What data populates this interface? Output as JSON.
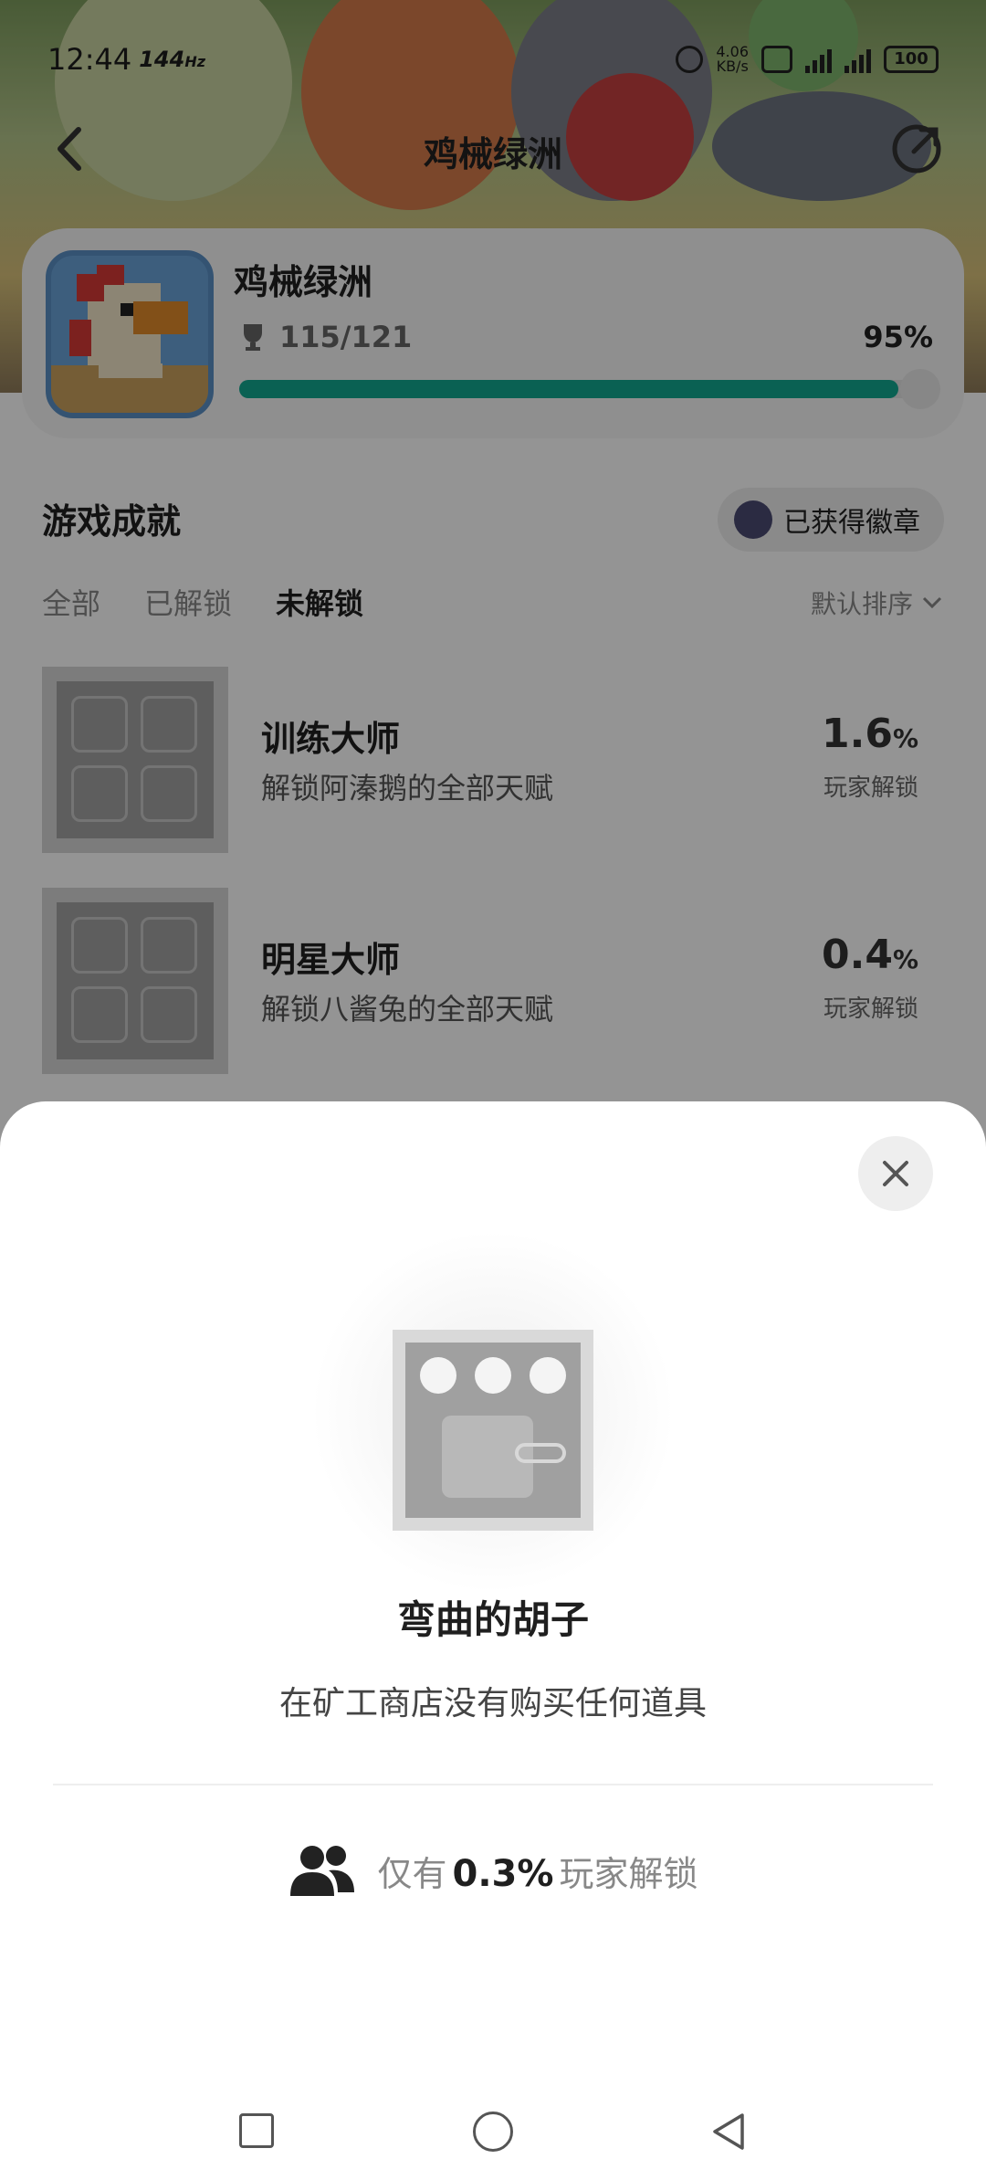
{
  "status_bar": {
    "time": "12:44",
    "refresh_rate": "144",
    "refresh_unit": "Hz",
    "net_speed": "4.06",
    "net_unit": "KB/s",
    "battery": "100"
  },
  "header": {
    "title": "鸡械绿洲"
  },
  "game_card": {
    "name": "鸡械绿洲",
    "trophy_count": "115/121",
    "percent_text": "95%",
    "progress": 0.95,
    "accent_color": "#12a78f"
  },
  "achievements_section": {
    "title": "游戏成就",
    "badges_button": "已获得徽章",
    "filters": [
      "全部",
      "已解锁",
      "未解锁"
    ],
    "active_filter": "未解锁",
    "sort_label": "默认排序",
    "items": [
      {
        "title": "训练大师",
        "desc": "解锁阿溱鹅的全部天赋",
        "value": "1.6",
        "unit": "%",
        "unlock_label": "玩家解锁"
      },
      {
        "title": "明星大师",
        "desc": "解锁八酱兔的全部天赋",
        "value": "0.4",
        "unit": "%",
        "unlock_label": "玩家解锁"
      }
    ]
  },
  "sheet": {
    "title": "弯曲的胡子",
    "description": "在矿工商店没有购买任何道具",
    "stat_prefix": "仅有",
    "stat_value": "0.3%",
    "stat_suffix": "玩家解锁"
  },
  "icons": {
    "back": "chevron-left-icon",
    "share": "share-icon",
    "trophy": "trophy-icon",
    "close": "close-icon",
    "users": "users-icon",
    "sort": "chevron-down-icon"
  }
}
